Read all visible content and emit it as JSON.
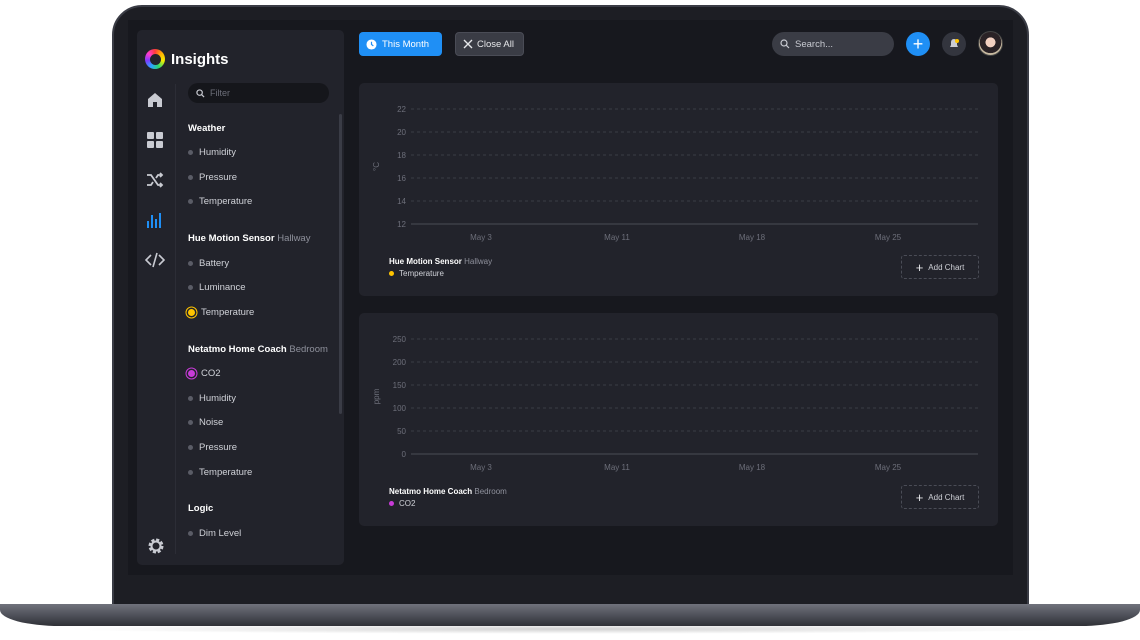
{
  "app": {
    "title": "Insights"
  },
  "sidebar": {
    "filter_placeholder": "Filter",
    "rail_icons": [
      "home-icon",
      "grid-icon",
      "shuffle-icon",
      "bar-chart-icon",
      "code-icon"
    ],
    "groups": [
      {
        "name": "Weather",
        "sub": "",
        "items": [
          "Humidity",
          "Pressure",
          "Temperature"
        ]
      },
      {
        "name": "Hue Motion Sensor",
        "sub": "Hallway",
        "items": [
          "Battery",
          "Luminance",
          "Temperature"
        ]
      },
      {
        "name": "Netatmo Home Coach",
        "sub": "Bedroom",
        "items": [
          "CO2",
          "Humidity",
          "Noise",
          "Pressure",
          "Temperature"
        ]
      },
      {
        "name": "Logic",
        "sub": "",
        "items": [
          "Dim Level"
        ]
      }
    ]
  },
  "topbar": {
    "this_month": "This Month",
    "close_all": "Close All",
    "search_placeholder": "Search..."
  },
  "colors": {
    "accent": "#1f8ff5",
    "temperature": "#ffc400",
    "co2": "#c83bd8"
  },
  "charts": [
    {
      "device": "Hue Motion Sensor",
      "room": "Hallway",
      "series": "Temperature",
      "add_label": "Add Chart"
    },
    {
      "device": "Netatmo Home Coach",
      "room": "Bedroom",
      "series": "CO2",
      "add_label": "Add Chart"
    }
  ],
  "chart_data": [
    {
      "type": "line",
      "ylabel": "°C",
      "yticks": [
        22,
        20,
        18,
        16,
        14,
        12
      ],
      "ylim": [
        12,
        22
      ],
      "xticks": [
        "May 3",
        "May 11",
        "May 18",
        "May 25"
      ],
      "series": [
        {
          "name": "Temperature",
          "values": []
        }
      ],
      "grid": true
    },
    {
      "type": "line",
      "ylabel": "ppm",
      "yticks": [
        250,
        200,
        150,
        100,
        50,
        0
      ],
      "ylim": [
        0,
        250
      ],
      "xticks": [
        "May 3",
        "May 11",
        "May 18",
        "May 25"
      ],
      "series": [
        {
          "name": "CO2",
          "values": []
        }
      ],
      "grid": true
    }
  ]
}
